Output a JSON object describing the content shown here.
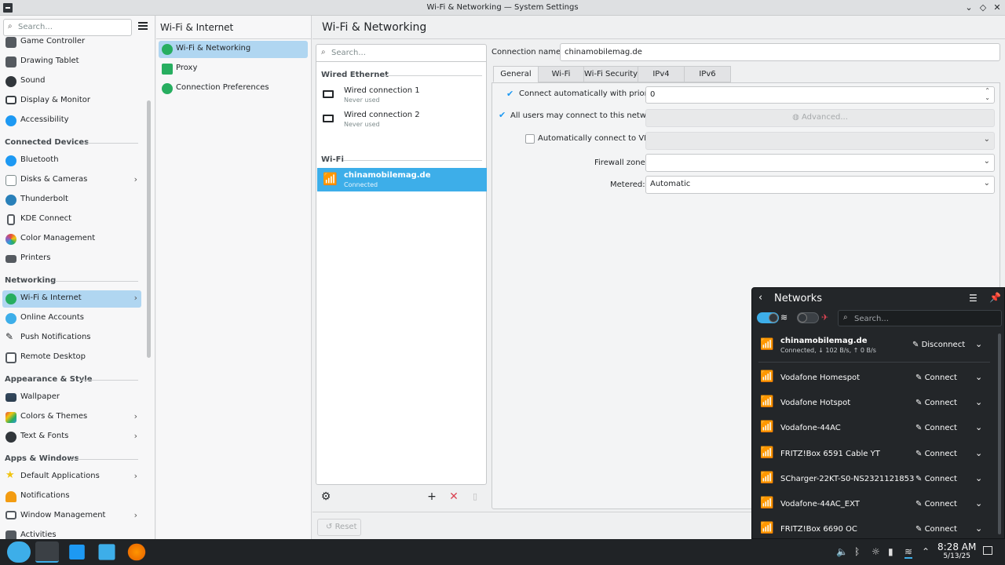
{
  "window": {
    "title": "Wi-Fi & Networking — System Settings"
  },
  "sidebar": {
    "search_placeholder": "Search...",
    "items": [
      {
        "label": "Game Controller",
        "color": "#555a60"
      },
      {
        "label": "Drawing Tablet",
        "color": "#555a60"
      },
      {
        "label": "Sound",
        "color": "#31363b"
      },
      {
        "label": "Display & Monitor",
        "color": "#3b4045"
      },
      {
        "label": "Accessibility",
        "color": "#1d99f3"
      },
      {
        "label": "Bluetooth",
        "color": "#1d99f3"
      },
      {
        "label": "Disks & Cameras",
        "color": "#7f8c8d"
      },
      {
        "label": "Thunderbolt",
        "color": "#2980b9"
      },
      {
        "label": "KDE Connect",
        "color": "#555a60"
      },
      {
        "label": "Color Management",
        "color": "#e74c3c"
      },
      {
        "label": "Printers",
        "color": "#555a60"
      },
      {
        "label": "Wi-Fi & Internet",
        "color": "#27ae60"
      },
      {
        "label": "Online Accounts",
        "color": "#3daee9"
      },
      {
        "label": "Push Notifications",
        "color": "#31363b"
      },
      {
        "label": "Remote Desktop",
        "color": "#555a60"
      },
      {
        "label": "Wallpaper",
        "color": "#2c3e50"
      },
      {
        "label": "Colors & Themes",
        "color": "#e67e22"
      },
      {
        "label": "Text & Fonts",
        "color": "#31363b"
      },
      {
        "label": "Default Applications",
        "color": "#f1c40f"
      },
      {
        "label": "Notifications",
        "color": "#f39c12"
      },
      {
        "label": "Window Management",
        "color": "#555a60"
      },
      {
        "label": "Activities",
        "color": "#555a60"
      }
    ],
    "headers": [
      "Connected Devices",
      "Networking",
      "Appearance & Style",
      "Apps & Windows"
    ]
  },
  "column2": {
    "header": "Wi-Fi & Internet",
    "items": [
      "Wi-Fi & Networking",
      "Proxy",
      "Connection Preferences"
    ]
  },
  "main": {
    "title": "Wi-Fi & Networking",
    "search_placeholder": "Search...",
    "wired_header": "Wired Ethernet",
    "wifi_header": "Wi-Fi",
    "connections": [
      {
        "name": "Wired connection 1",
        "status": "Never used"
      },
      {
        "name": "Wired connection 2",
        "status": "Never used"
      },
      {
        "name": "chinamobilemag.de",
        "status": "Connected"
      }
    ],
    "connection_name_label": "Connection name:",
    "connection_name": "chinamobilemag.de",
    "tabs": [
      "General",
      "Wi-Fi",
      "Wi-Fi Security",
      "IPv4",
      "IPv6"
    ],
    "general": {
      "auto_priority_label": "Connect automatically with priority",
      "priority": "0",
      "all_users_label": "All users may connect to this network",
      "advanced_label": "Advanced...",
      "vpn_label": "Automatically connect to VPN",
      "firewall_label": "Firewall zone:",
      "metered_label": "Metered:",
      "metered_value": "Automatic"
    },
    "reset_label": "Reset"
  },
  "networks_popup": {
    "title": "Networks",
    "search_placeholder": "Search...",
    "active": {
      "name": "chinamobilemag.de",
      "status": "Connected, ↓ 102 B/s, ↑ 0 B/s",
      "action": "Disconnect"
    },
    "list": [
      {
        "name": "Vodafone Homespot",
        "action": "Connect"
      },
      {
        "name": "Vodafone Hotspot",
        "action": "Connect"
      },
      {
        "name": "Vodafone-44AC",
        "action": "Connect"
      },
      {
        "name": "FRITZ!Box 6591 Cable YT",
        "action": "Connect"
      },
      {
        "name": "SCharger-22KT-S0-NS2321121853",
        "action": "Connect"
      },
      {
        "name": "Vodafone-44AC_EXT",
        "action": "Connect"
      },
      {
        "name": "FRITZ!Box 6690 OC",
        "action": "Connect"
      }
    ]
  },
  "taskbar": {
    "time": "8:28 AM",
    "date": "5/13/25"
  }
}
